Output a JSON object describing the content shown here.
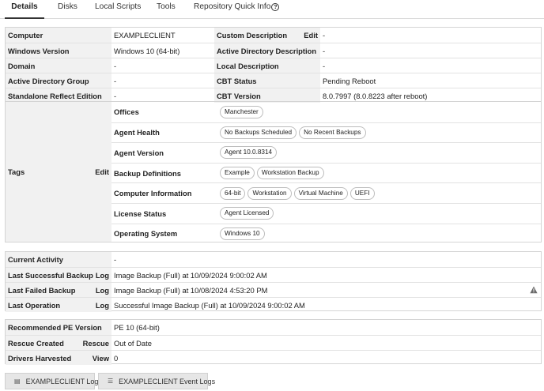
{
  "tabs": {
    "details": "Details",
    "disks": "Disks",
    "local_scripts": "Local Scripts",
    "tools": "Tools",
    "repo_info": "Repository Quick Info"
  },
  "actions": {
    "edit": "Edit",
    "log": "Log",
    "rescue": "Rescue",
    "view": "View"
  },
  "summary": {
    "computer_label": "Computer",
    "computer_value": "EXAMPLECLIENT",
    "custom_desc_label": "Custom Description",
    "custom_desc_value": "-",
    "windows_label": "Windows Version",
    "windows_value": "Windows 10 (64-bit)",
    "ad_desc_label": "Active Directory Description",
    "ad_desc_value": "-",
    "domain_label": "Domain",
    "domain_value": "-",
    "local_desc_label": "Local Description",
    "local_desc_value": "-",
    "ad_group_label": "Active Directory Group",
    "ad_group_value": "-",
    "cbt_status_label": "CBT Status",
    "cbt_status_value": "Pending Reboot",
    "standalone_label": "Standalone Reflect Edition",
    "standalone_value": "-",
    "cbt_version_label": "CBT Version",
    "cbt_version_value": "8.0.7997 (8.0.8223 after reboot)"
  },
  "tags": {
    "label": "Tags",
    "rows": [
      {
        "name": "Offices",
        "pills": [
          "Manchester"
        ]
      },
      {
        "name": "Agent Health",
        "pills": [
          "No Backups Scheduled",
          "No Recent Backups"
        ]
      },
      {
        "name": "Agent Version",
        "pills": [
          "Agent 10.0.8314"
        ]
      },
      {
        "name": "Backup Definitions",
        "pills": [
          "Example",
          "Workstation Backup"
        ]
      },
      {
        "name": "Computer Information",
        "pills": [
          "64-bit",
          "Workstation",
          "Virtual Machine",
          "UEFI"
        ]
      },
      {
        "name": "License Status",
        "pills": [
          "Agent Licensed"
        ]
      },
      {
        "name": "Operating System",
        "pills": [
          "Windows 10"
        ]
      }
    ]
  },
  "activity": {
    "current_label": "Current Activity",
    "current_value": "-",
    "last_success_label": "Last Successful Backup",
    "last_success_value": "Image Backup (Full) at 10/09/2024 9:00:02 AM",
    "last_failed_label": "Last Failed Backup",
    "last_failed_value": "Image Backup (Full) at 10/08/2024 4:53:20 PM",
    "last_op_label": "Last Operation",
    "last_op_value": "Successful Image Backup (Full) at 10/09/2024 9:00:02 AM"
  },
  "rescue": {
    "pe_label": "Recommended PE Version",
    "pe_value": "PE 10 (64-bit)",
    "rescue_label": "Rescue Created",
    "rescue_value": "Out of Date",
    "drivers_label": "Drivers Harvested",
    "drivers_value": "0"
  },
  "buttons": {
    "logs": "EXAMPLECLIENT Logs",
    "event_logs": "EXAMPLECLIENT Event Logs"
  },
  "icons": {
    "info": "info-icon",
    "warning": "warning-icon",
    "logs": "log-file-icon",
    "event_logs": "event-list-icon"
  },
  "colors": {
    "label_bg": "#f1f1f1",
    "border": "#d4d4d4",
    "button_bg": "#e6e6e6"
  }
}
